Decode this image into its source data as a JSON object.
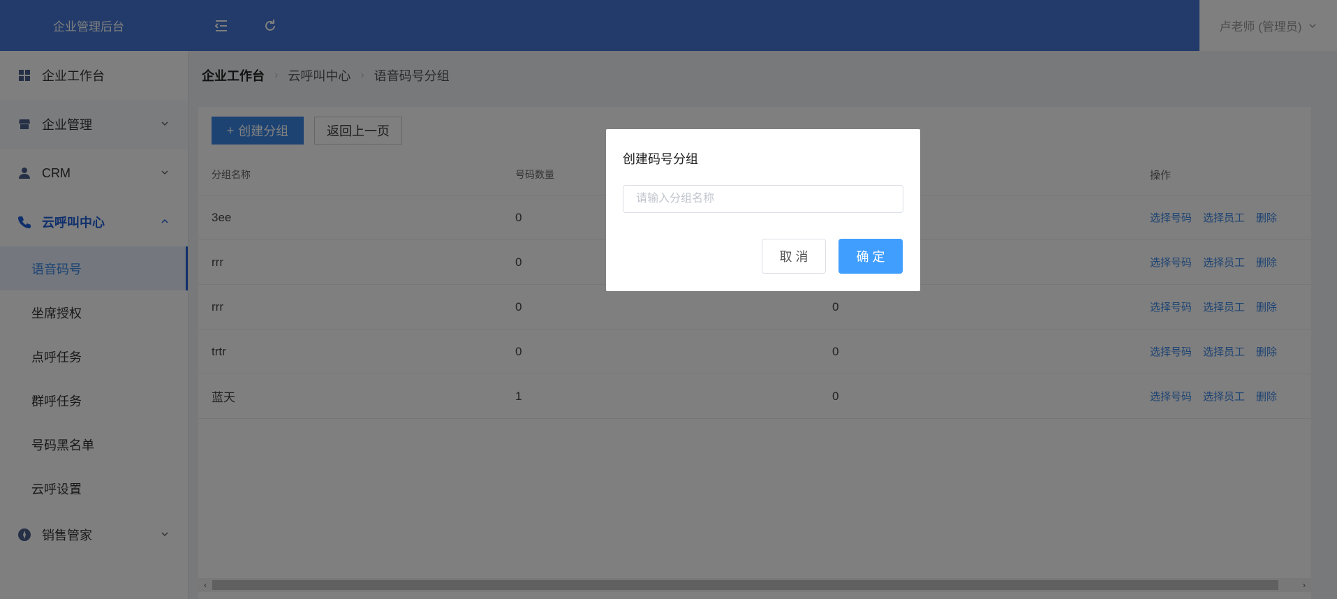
{
  "header": {
    "brand": "企业管理后台",
    "user": "卢老师 (管理员)"
  },
  "sidebar": {
    "items": [
      {
        "label": "企业工作台",
        "icon": "grid-icon"
      },
      {
        "label": "企业管理",
        "icon": "store-icon"
      },
      {
        "label": "CRM",
        "icon": "user-icon"
      },
      {
        "label": "云呼叫中心",
        "icon": "phone-icon"
      },
      {
        "label": "销售管家",
        "icon": "compass-icon"
      }
    ],
    "sub_items": [
      "语音码号",
      "坐席授权",
      "点呼任务",
      "群呼任务",
      "号码黑名单",
      "云呼设置"
    ],
    "selected_sub": "语音码号"
  },
  "breadcrumb": [
    "企业工作台",
    "云呼叫中心",
    "语音码号分组"
  ],
  "toolbar": {
    "create_label": "创建分组",
    "back_label": "返回上一页"
  },
  "table": {
    "columns": [
      "分组名称",
      "号码数量",
      "",
      "操作"
    ],
    "rows": [
      {
        "name": "3ee",
        "count": "0",
        "third": "",
        "ops": [
          "选择号码",
          "选择员工",
          "删除"
        ]
      },
      {
        "name": "rrr",
        "count": "0",
        "third": "",
        "ops": [
          "选择号码",
          "选择员工",
          "删除"
        ]
      },
      {
        "name": "rrr",
        "count": "0",
        "third": "0",
        "ops": [
          "选择号码",
          "选择员工",
          "删除"
        ]
      },
      {
        "name": "trtr",
        "count": "0",
        "third": "0",
        "ops": [
          "选择号码",
          "选择员工",
          "删除"
        ]
      },
      {
        "name": "蓝天",
        "count": "1",
        "third": "0",
        "ops": [
          "选择号码",
          "选择员工",
          "删除"
        ]
      }
    ]
  },
  "dialog": {
    "title": "创建码号分组",
    "placeholder": "请输入分组名称",
    "cancel_label": "取 消",
    "ok_label": "确 定"
  },
  "colors": {
    "header_bg": "#4577d4",
    "primary": "#3b86e6",
    "active_menu": "#1f5fd8",
    "ok_button": "#409eff"
  }
}
